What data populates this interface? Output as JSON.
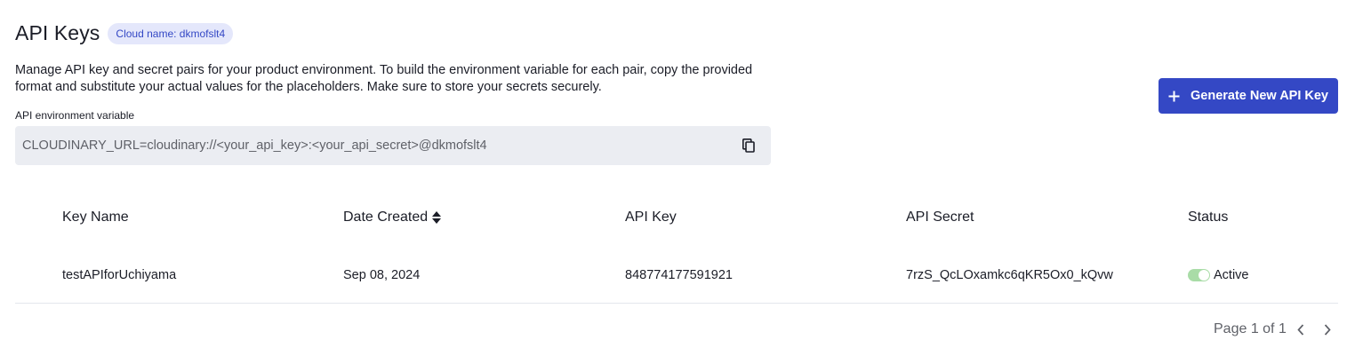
{
  "header": {
    "title": "API Keys",
    "cloud_badge": "Cloud name: dkmofslt4",
    "description": "Manage API key and secret pairs for your product environment. To build the environment variable for each pair, copy the provided format and substitute your actual values for the placeholders. Make sure to store your secrets securely."
  },
  "env": {
    "label": "API environment variable",
    "value": "CLOUDINARY_URL=cloudinary://<your_api_key>:<your_api_secret>@dkmofslt4"
  },
  "actions": {
    "generate_label": "Generate New API Key"
  },
  "table": {
    "columns": {
      "key_name": "Key Name",
      "date_created": "Date Created",
      "api_key": "API Key",
      "api_secret": "API Secret",
      "status": "Status"
    },
    "rows": [
      {
        "key_name": "testAPIforUchiyama",
        "date_created": "Sep 08, 2024",
        "api_key": "848774177591921",
        "api_secret": "7rzS_QcLOxamkc6qKR5Ox0_kQvw",
        "status": "Active"
      }
    ]
  },
  "pagination": {
    "label": "Page 1 of 1"
  },
  "colors": {
    "accent": "#3448c5",
    "badge_bg": "#e4e7fb",
    "env_bg": "#ebedf2",
    "toggle_on": "#a9dca7"
  },
  "icons": {
    "copy": "copy-icon",
    "plus": "plus-icon",
    "sort": "sort-icon",
    "prev": "chevron-left-icon",
    "next": "chevron-right-icon"
  }
}
